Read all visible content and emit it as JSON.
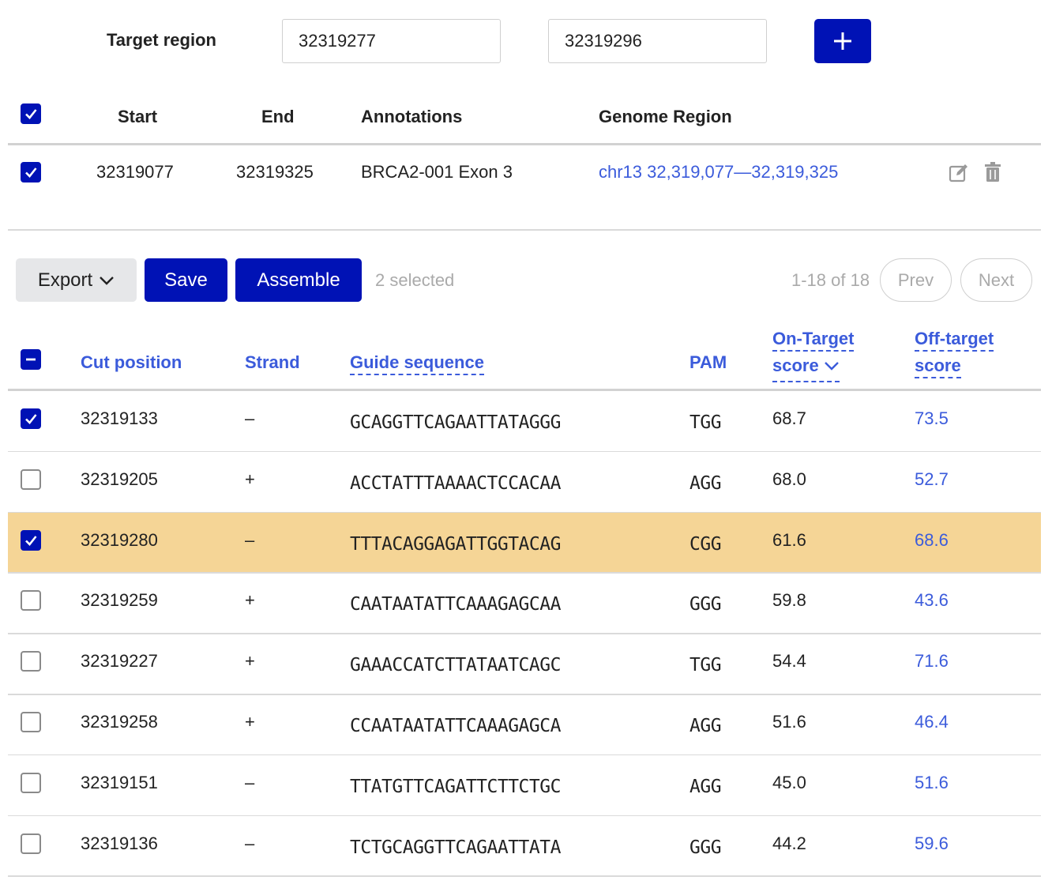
{
  "target": {
    "label": "Target region",
    "start_value": "32319277",
    "end_value": "32319296",
    "add_icon": "plus-icon"
  },
  "region_table": {
    "headers": {
      "start": "Start",
      "end": "End",
      "annotations": "Annotations",
      "genome_region": "Genome Region"
    },
    "all_checked": true,
    "rows": [
      {
        "checked": true,
        "start": "32319077",
        "end": "32319325",
        "annotation": "BRCA2-001 Exon 3",
        "genome_region": "chr13 32,319,077—32,319,325"
      }
    ]
  },
  "toolbar": {
    "export_label": "Export",
    "save_label": "Save",
    "assemble_label": "Assemble",
    "selected_text": "2 selected",
    "range_text": "1-18 of 18",
    "prev_label": "Prev",
    "next_label": "Next"
  },
  "guide_table": {
    "headers": {
      "cut_position": "Cut position",
      "strand": "Strand",
      "guide_sequence": "Guide sequence",
      "pam": "PAM",
      "on_target_line1": "On-Target",
      "on_target_line2": "score",
      "off_target_line1": "Off-target",
      "off_target_line2": "score"
    },
    "rows": [
      {
        "checked": true,
        "highlight": false,
        "cut": "32319133",
        "strand": "–",
        "seq": "GCAGGTTCAGAATTATAGGG",
        "pam": "TGG",
        "on": "68.7",
        "off": "73.5"
      },
      {
        "checked": false,
        "highlight": false,
        "cut": "32319205",
        "strand": "+",
        "seq": "ACCTATTTAAAACTCCACAA",
        "pam": "AGG",
        "on": "68.0",
        "off": "52.7"
      },
      {
        "checked": true,
        "highlight": true,
        "cut": "32319280",
        "strand": "–",
        "seq": "TTTACAGGAGATTGGTACAG",
        "pam": "CGG",
        "on": "61.6",
        "off": "68.6"
      },
      {
        "checked": false,
        "highlight": false,
        "cut": "32319259",
        "strand": "+",
        "seq": "CAATAATATTCAAAGAGCAA",
        "pam": "GGG",
        "on": "59.8",
        "off": "43.6"
      },
      {
        "checked": false,
        "highlight": false,
        "cut": "32319227",
        "strand": "+",
        "seq": "GAAACCATCTTATAATCAGC",
        "pam": "TGG",
        "on": "54.4",
        "off": "71.6"
      },
      {
        "checked": false,
        "highlight": false,
        "cut": "32319258",
        "strand": "+",
        "seq": "CCAATAATATTCAAAGAGCA",
        "pam": "AGG",
        "on": "51.6",
        "off": "46.4"
      },
      {
        "checked": false,
        "highlight": false,
        "cut": "32319151",
        "strand": "–",
        "seq": "TTATGTTCAGATTCTTCTGC",
        "pam": "AGG",
        "on": "45.0",
        "off": "51.6"
      },
      {
        "checked": false,
        "highlight": false,
        "cut": "32319136",
        "strand": "–",
        "seq": "TCTGCAGGTTCAGAATTATA",
        "pam": "GGG",
        "on": "44.2",
        "off": "59.6"
      }
    ]
  },
  "colors": {
    "primary": "#0012b5",
    "link": "#3b5bdb",
    "highlight_row": "#f5d596",
    "muted": "#aaaaaa"
  }
}
